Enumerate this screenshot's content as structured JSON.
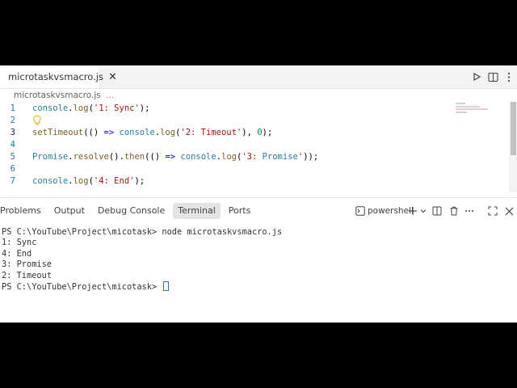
{
  "tab": {
    "label": "microtaskvsmacro.js",
    "close": "✕"
  },
  "breadcrumb": {
    "file": "microtaskvsmacro.js",
    "more": "…"
  },
  "editor": {
    "lines": [
      {
        "num": "1",
        "text": "console.log('1: Sync');"
      },
      {
        "num": "2",
        "text": ""
      },
      {
        "num": "3",
        "text": "setTimeout(() => console.log('2: Timeout'), 0);"
      },
      {
        "num": "4",
        "text": ""
      },
      {
        "num": "5",
        "text": "Promise.resolve().then(() => console.log('3: Promise'));"
      },
      {
        "num": "6",
        "text": ""
      },
      {
        "num": "7",
        "text": "console.log('4: End');"
      }
    ]
  },
  "panel": {
    "tabs": [
      "Problems",
      "Output",
      "Debug Console",
      "Terminal",
      "Ports"
    ],
    "active_tab": "Terminal",
    "shell_label": "powershell"
  },
  "terminal": {
    "lines": [
      "PS C:\\YouTube\\Project\\micotask> node microtaskvsmacro.js",
      "1: Sync",
      "4: End",
      "3: Promise",
      "2: Timeout",
      "PS C:\\YouTube\\Project\\micotask> "
    ]
  },
  "colors": {
    "accent": "#2c75c8",
    "line_number": "#237893",
    "string": "#a31515",
    "function": "#795e26",
    "number": "#098658"
  }
}
